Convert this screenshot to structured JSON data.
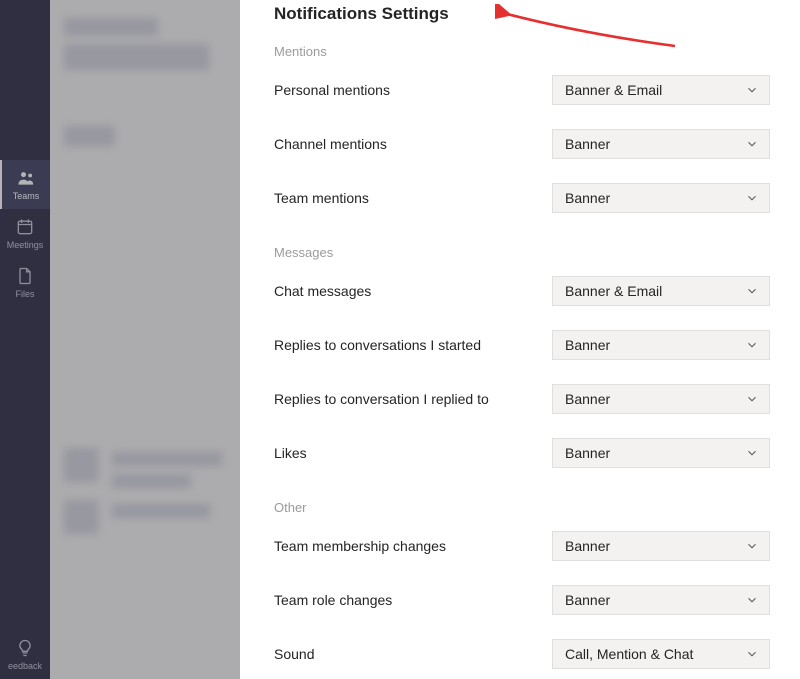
{
  "rail": {
    "items": [
      {
        "key": "teams",
        "label": "Teams",
        "active": true
      },
      {
        "key": "meetings",
        "label": "Meetings",
        "active": false
      },
      {
        "key": "files",
        "label": "Files",
        "active": false
      }
    ],
    "feedback_label": "eedback"
  },
  "settings": {
    "title": "Notifications Settings",
    "sections": [
      {
        "title": "Mentions",
        "rows": [
          {
            "label": "Personal mentions",
            "value": "Banner & Email"
          },
          {
            "label": "Channel mentions",
            "value": "Banner"
          },
          {
            "label": "Team mentions",
            "value": "Banner"
          }
        ]
      },
      {
        "title": "Messages",
        "rows": [
          {
            "label": "Chat messages",
            "value": "Banner & Email"
          },
          {
            "label": "Replies to conversations I started",
            "value": "Banner"
          },
          {
            "label": "Replies to conversation I replied to",
            "value": "Banner"
          },
          {
            "label": "Likes",
            "value": "Banner"
          }
        ]
      },
      {
        "title": "Other",
        "rows": [
          {
            "label": "Team membership changes",
            "value": "Banner"
          },
          {
            "label": "Team role changes",
            "value": "Banner"
          },
          {
            "label": "Sound",
            "value": "Call, Mention & Chat"
          }
        ]
      }
    ]
  }
}
